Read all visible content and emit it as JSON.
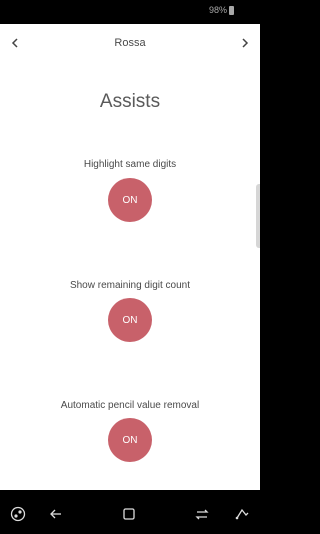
{
  "status_bar": {
    "battery_text": "98%",
    "battery_icon": "battery-icon"
  },
  "header": {
    "title": "Rossa",
    "prev_icon": "chevron-left-icon",
    "next_icon": "chevron-right-icon"
  },
  "section": {
    "title": "Assists"
  },
  "settings": [
    {
      "label": "Highlight same digits",
      "value": "ON"
    },
    {
      "label": "Show remaining digit count",
      "value": "ON"
    },
    {
      "label": "Automatic pencil value removal",
      "value": "ON"
    }
  ],
  "colors": {
    "toggle_on": "#c8616a",
    "background": "#ffffff",
    "system_bar": "#000000"
  },
  "system_nav": {
    "buttons": [
      "dpad-icon",
      "back-icon",
      "home-icon",
      "recents-icon",
      "pen-gesture-icon"
    ]
  }
}
